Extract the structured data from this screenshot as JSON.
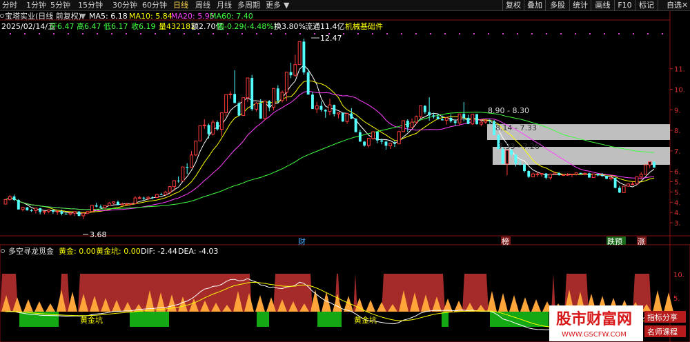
{
  "toolbar": {
    "tabs": [
      "分时",
      "1分钟",
      "5分钟",
      "15分钟",
      "30分钟",
      "60分钟",
      "日线",
      "周线",
      "月线",
      "多周期",
      "更多"
    ],
    "active": "日线",
    "right_buttons": [
      "复权",
      "叠加",
      "多股",
      "统计",
      "画线",
      "F10",
      "标记",
      "自选"
    ]
  },
  "header": {
    "stock": "宝塔实业(日线 前复权)",
    "ma5_label": "MA5: 6.18",
    "ma10_label": "MA10: 5.84",
    "ma20_label": "MA20: 5.95",
    "ma60_label": "MA60: 7.40",
    "date": "2025/02/14/五",
    "open": "开6.47",
    "high": "高6.47",
    "low": "低6.17",
    "close": "收6.19",
    "volume": "量432181",
    "amount": "额2.70亿",
    "change": "幅-0.29(-4.48%)",
    "turnover": "换3.80%",
    "float": "流通11.4亿",
    "sector": "机械基础件"
  },
  "price_axis": [
    "11.",
    "10.",
    "9.",
    "8.",
    "7.",
    "6.",
    "5.",
    "5.",
    "4.",
    "4.",
    "3."
  ],
  "annotations": {
    "high": "12.47",
    "low": "3.68",
    "zone1": "8.90 - 8.30",
    "zone2": "8.14 - 7.33",
    "zone3": "7.33 - 7.26"
  },
  "markers": [
    "财",
    "榜",
    "跌预",
    "涨"
  ],
  "indicator": {
    "name": "多空寻龙觅金",
    "gold_label": "黄金: 0.00",
    "pit_label": "黄金坑: 0.00",
    "dif_label": "DIF: -2.44",
    "dea_label": "DEA: -4.03",
    "pit_text_1": "黄金坑",
    "pit_text_2": "黄金坑",
    "axis_labels": [
      "10.",
      "5."
    ]
  },
  "watermark": {
    "title": "股市财富网",
    "url": "WWW.GSCFW.COM",
    "tag1": "指标分享",
    "tag2": "名师课程"
  },
  "chart_data": {
    "type": "candlestick",
    "ylim": [
      3.0,
      12.6
    ],
    "ohlc": [
      [
        4.41,
        4.63,
        4.41,
        4.63
      ],
      [
        4.63,
        4.85,
        4.58,
        4.78
      ],
      [
        4.78,
        4.87,
        4.56,
        4.61
      ],
      [
        4.61,
        4.65,
        4.14,
        4.15
      ],
      [
        4.15,
        4.28,
        4.06,
        4.25
      ],
      [
        4.25,
        4.27,
        4.09,
        4.11
      ],
      [
        4.11,
        4.18,
        4.03,
        4.1
      ],
      [
        4.1,
        4.21,
        3.95,
        4.21
      ],
      [
        4.21,
        4.22,
        3.91,
        4.02
      ],
      [
        4.02,
        4.08,
        3.91,
        4.05
      ],
      [
        4.05,
        4.16,
        3.97,
        4.13
      ],
      [
        4.13,
        4.14,
        3.94,
        4.04
      ],
      [
        4.04,
        4.11,
        3.89,
        4.06
      ],
      [
        4.06,
        4.14,
        3.86,
        3.94
      ],
      [
        3.94,
        4.0,
        3.9,
        3.92
      ],
      [
        3.92,
        4.04,
        3.85,
        3.97
      ],
      [
        3.97,
        4.05,
        3.83,
        4.05
      ],
      [
        4.05,
        4.07,
        3.81,
        3.84
      ],
      [
        3.84,
        3.99,
        3.68,
        3.97
      ],
      [
        3.97,
        4.06,
        3.92,
        4.05
      ],
      [
        4.05,
        4.38,
        4.05,
        4.35
      ],
      [
        4.35,
        4.47,
        4.25,
        4.29
      ],
      [
        4.29,
        4.39,
        4.21,
        4.24
      ],
      [
        4.24,
        4.36,
        4.16,
        4.34
      ],
      [
        4.34,
        4.51,
        4.32,
        4.46
      ],
      [
        4.46,
        4.53,
        4.39,
        4.52
      ],
      [
        4.52,
        4.58,
        4.34,
        4.37
      ],
      [
        4.37,
        4.48,
        4.35,
        4.41
      ],
      [
        4.41,
        4.46,
        4.36,
        4.42
      ],
      [
        4.42,
        4.45,
        4.37,
        4.43
      ],
      [
        4.43,
        4.79,
        4.43,
        4.71
      ],
      [
        4.71,
        4.81,
        4.66,
        4.72
      ],
      [
        4.72,
        4.77,
        4.6,
        4.68
      ],
      [
        4.68,
        4.8,
        4.61,
        4.74
      ],
      [
        4.74,
        4.79,
        4.65,
        4.73
      ],
      [
        4.73,
        4.91,
        4.71,
        4.88
      ],
      [
        4.88,
        4.96,
        4.85,
        4.87
      ],
      [
        4.87,
        5.06,
        4.84,
        4.99
      ],
      [
        4.99,
        5.29,
        4.9,
        5.26
      ],
      [
        5.26,
        5.57,
        5.05,
        5.55
      ],
      [
        5.55,
        5.76,
        5.45,
        5.53
      ],
      [
        5.53,
        6.22,
        5.53,
        6.22
      ],
      [
        6.22,
        6.4,
        5.87,
        6.18
      ],
      [
        6.18,
        6.99,
        6.18,
        6.8
      ],
      [
        6.8,
        7.48,
        6.75,
        7.48
      ],
      [
        7.48,
        8.23,
        7.48,
        8.23
      ],
      [
        8.23,
        8.54,
        8.07,
        8.26
      ],
      [
        8.26,
        8.33,
        7.6,
        7.82
      ],
      [
        7.82,
        8.51,
        7.75,
        8.4
      ],
      [
        8.4,
        8.48,
        7.99,
        8.05
      ],
      [
        8.05,
        8.86,
        7.72,
        8.86
      ],
      [
        8.86,
        9.74,
        8.68,
        9.74
      ],
      [
        9.74,
        9.9,
        9.55,
        9.77
      ],
      [
        9.77,
        10.93,
        9.33,
        9.33
      ],
      [
        9.33,
        9.4,
        8.69,
        8.72
      ],
      [
        8.72,
        9.59,
        8.72,
        9.59
      ],
      [
        9.59,
        10.55,
        9.38,
        10.55
      ],
      [
        10.55,
        10.7,
        8.95,
        9.03
      ],
      [
        9.03,
        9.38,
        8.92,
        9.32
      ],
      [
        9.32,
        9.52,
        8.56,
        8.57
      ],
      [
        8.57,
        9.43,
        8.5,
        9.43
      ],
      [
        9.43,
        9.47,
        8.93,
        9.13
      ],
      [
        9.13,
        10.04,
        8.96,
        10.04
      ],
      [
        10.04,
        10.2,
        9.31,
        9.45
      ],
      [
        9.45,
        9.94,
        9.36,
        9.85
      ],
      [
        9.85,
        10.84,
        9.42,
        10.84
      ],
      [
        10.84,
        11.29,
        10.54,
        10.68
      ],
      [
        10.68,
        11.68,
        10.6,
        11.2
      ],
      [
        11.2,
        12.32,
        11.2,
        12.32
      ],
      [
        12.32,
        12.47,
        10.7,
        10.82
      ],
      [
        10.82,
        10.99,
        9.74,
        9.74
      ],
      [
        9.74,
        9.88,
        9.04,
        9.04
      ],
      [
        9.04,
        9.39,
        8.84,
        9.19
      ],
      [
        9.19,
        9.41,
        8.91,
        9.0
      ],
      [
        9.0,
        9.03,
        8.61,
        8.92
      ],
      [
        8.92,
        9.54,
        8.73,
        9.24
      ],
      [
        9.24,
        9.26,
        8.68,
        8.8
      ],
      [
        8.8,
        8.85,
        8.59,
        8.85
      ],
      [
        8.85,
        8.86,
        8.41,
        8.43
      ],
      [
        8.43,
        8.84,
        8.32,
        8.82
      ],
      [
        8.82,
        9.08,
        8.55,
        8.57
      ],
      [
        8.57,
        8.59,
        7.91,
        7.91
      ],
      [
        7.91,
        8.03,
        7.45,
        7.45
      ],
      [
        7.45,
        7.48,
        7.21,
        7.26
      ],
      [
        7.26,
        7.63,
        7.17,
        7.61
      ],
      [
        7.61,
        7.95,
        7.54,
        7.93
      ],
      [
        7.93,
        7.94,
        7.37,
        7.51
      ],
      [
        7.51,
        7.6,
        7.32,
        7.45
      ],
      [
        7.45,
        7.51,
        7.06,
        7.25
      ],
      [
        7.25,
        7.4,
        7.09,
        7.37
      ],
      [
        7.37,
        7.49,
        7.19,
        7.34
      ],
      [
        7.34,
        7.98,
        7.34,
        7.94
      ],
      [
        7.94,
        8.47,
        7.93,
        8.47
      ],
      [
        8.47,
        8.54,
        7.92,
        8.15
      ],
      [
        8.15,
        8.58,
        8.14,
        8.4
      ],
      [
        8.4,
        8.73,
        8.3,
        8.67
      ],
      [
        8.67,
        9.2,
        8.6,
        9.19
      ],
      [
        9.19,
        9.23,
        8.8,
        8.89
      ],
      [
        8.89,
        9.61,
        8.48,
        8.73
      ],
      [
        8.73,
        8.85,
        8.58,
        8.67
      ],
      [
        8.67,
        8.79,
        8.52,
        8.54
      ],
      [
        8.54,
        8.73,
        8.48,
        8.49
      ],
      [
        8.49,
        8.63,
        8.28,
        8.61
      ],
      [
        8.61,
        8.78,
        8.37,
        8.44
      ],
      [
        8.44,
        8.55,
        8.21,
        8.36
      ],
      [
        8.36,
        8.8,
        8.22,
        8.8
      ],
      [
        8.8,
        9.38,
        8.44,
        8.61
      ],
      [
        8.61,
        8.76,
        8.3,
        8.31
      ],
      [
        8.31,
        8.81,
        8.27,
        8.79
      ],
      [
        8.79,
        8.79,
        8.28,
        8.3
      ],
      [
        8.3,
        8.52,
        8.2,
        8.4
      ],
      [
        8.4,
        8.56,
        8.33,
        8.47
      ],
      [
        8.47,
        8.55,
        8.29,
        8.45
      ],
      [
        8.45,
        8.5,
        7.77,
        7.77
      ],
      [
        7.77,
        7.83,
        7.08,
        7.08
      ],
      [
        7.08,
        7.19,
        6.37,
        6.37
      ],
      [
        6.37,
        7.03,
        5.81,
        7.03
      ],
      [
        7.03,
        7.12,
        6.7,
        6.82
      ],
      [
        6.82,
        6.83,
        6.24,
        6.38
      ],
      [
        6.38,
        6.58,
        6.29,
        6.34
      ],
      [
        6.34,
        6.35,
        5.95,
        6.02
      ],
      [
        6.02,
        6.06,
        5.68,
        5.74
      ],
      [
        5.74,
        5.96,
        5.71,
        5.88
      ],
      [
        5.88,
        5.98,
        5.73,
        5.88
      ],
      [
        5.88,
        5.92,
        5.74,
        5.9
      ],
      [
        5.9,
        5.92,
        5.61,
        5.69
      ],
      [
        5.69,
        5.9,
        5.6,
        5.87
      ],
      [
        5.87,
        5.99,
        5.84,
        5.92
      ],
      [
        5.92,
        5.97,
        5.79,
        5.83
      ],
      [
        5.83,
        5.86,
        5.78,
        5.84
      ],
      [
        5.84,
        5.92,
        5.79,
        5.85
      ],
      [
        5.85,
        5.88,
        5.72,
        5.87
      ],
      [
        5.87,
        5.94,
        5.81,
        5.93
      ],
      [
        5.93,
        5.94,
        5.85,
        5.87
      ],
      [
        5.87,
        5.95,
        5.81,
        5.91
      ],
      [
        5.91,
        5.94,
        5.7,
        5.7
      ],
      [
        5.7,
        5.89,
        5.7,
        5.88
      ],
      [
        5.88,
        5.9,
        5.76,
        5.81
      ],
      [
        5.81,
        5.92,
        5.74,
        5.78
      ],
      [
        5.78,
        5.79,
        5.63,
        5.64
      ],
      [
        5.64,
        5.72,
        5.56,
        5.69
      ],
      [
        5.69,
        5.7,
        5.18,
        5.2
      ],
      [
        5.2,
        5.3,
        4.95,
        4.97
      ],
      [
        4.97,
        5.29,
        4.96,
        5.28
      ],
      [
        5.28,
        5.41,
        5.26,
        5.39
      ],
      [
        5.39,
        5.5,
        5.34,
        5.39
      ],
      [
        5.39,
        5.74,
        5.36,
        5.74
      ],
      [
        5.74,
        5.96,
        5.6,
        5.86
      ],
      [
        5.86,
        6.32,
        5.86,
        6.32
      ],
      [
        6.32,
        6.47,
        6.16,
        6.47
      ],
      [
        6.47,
        6.47,
        6.17,
        6.19
      ]
    ]
  }
}
